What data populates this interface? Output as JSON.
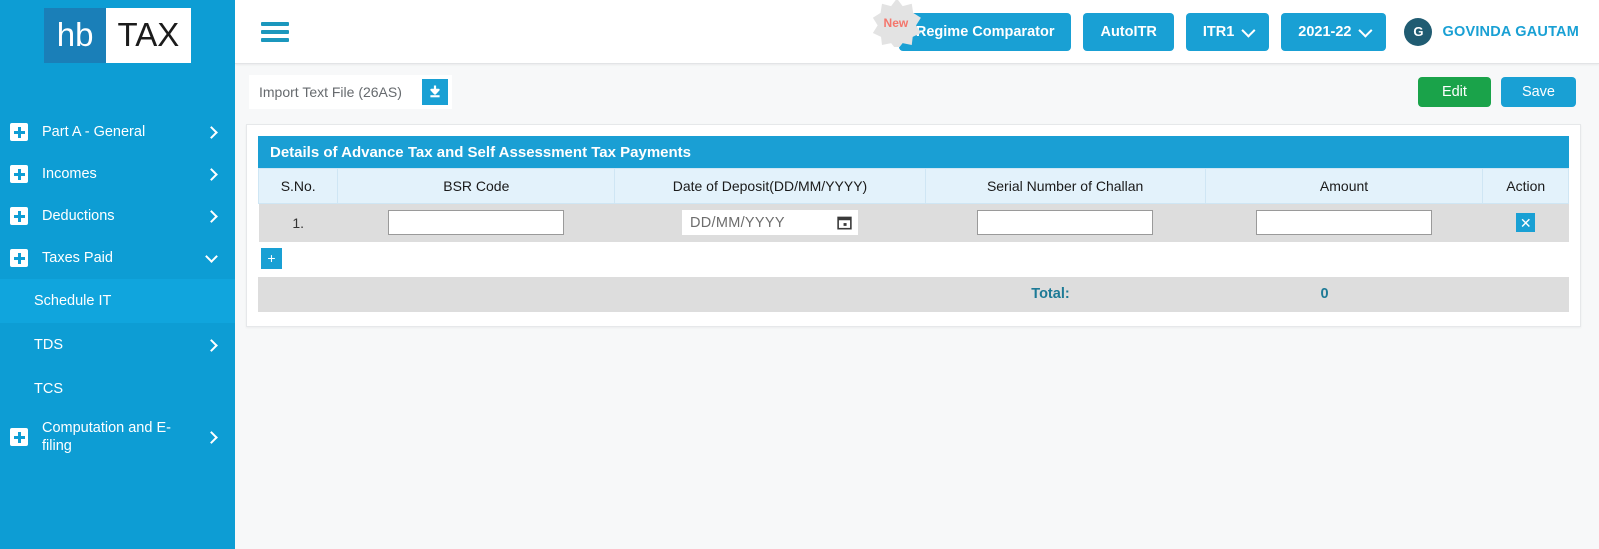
{
  "brand": {
    "logo_primary": "hb",
    "logo_secondary": "TAX",
    "accent_blue": "#0d9dd4",
    "header_blue": "#19a0d4",
    "green": "#1aa34a",
    "teal_text": "#1d7a96"
  },
  "sidebar": {
    "items": [
      {
        "label": "Part A - General",
        "icon": "plus-box-icon",
        "chevron": "chevron-right-icon",
        "level": "top"
      },
      {
        "label": "Incomes",
        "icon": "plus-box-icon",
        "chevron": "chevron-right-icon",
        "level": "top"
      },
      {
        "label": "Deductions",
        "icon": "plus-box-icon",
        "chevron": "chevron-right-icon",
        "level": "top"
      },
      {
        "label": "Taxes Paid",
        "icon": "plus-box-icon",
        "chevron": "chevron-down-icon",
        "level": "top",
        "expanded": true
      },
      {
        "label": "Schedule IT",
        "level": "sub",
        "active": true
      },
      {
        "label": "TDS",
        "level": "sub",
        "chevron": "chevron-right-icon"
      },
      {
        "label": "TCS",
        "level": "sub"
      },
      {
        "label": "Computation and E-filing",
        "icon": "plus-box-icon",
        "chevron": "chevron-right-icon",
        "level": "top"
      }
    ]
  },
  "header": {
    "menu_icon": "hamburger-icon",
    "new_badge": "New",
    "regime_comparator": "Regime Comparator",
    "auto_itr": "AutoITR",
    "itr_form": "ITR1",
    "assessment_year": "2021-22",
    "user_initial": "G",
    "user_name": "GOVINDA GAUTAM"
  },
  "actionbar": {
    "import_label": "Import Text File (26AS)",
    "download_icon": "download-icon",
    "edit_label": "Edit",
    "save_label": "Save"
  },
  "panel": {
    "title": "Details of Advance Tax and Self Assessment Tax Payments",
    "columns": [
      "S.No.",
      "BSR Code",
      "Date of Deposit(DD/MM/YYYY)",
      "Serial Number of Challan",
      "Amount",
      "Action"
    ],
    "rows": [
      {
        "sno": "1.",
        "bsr_code": "",
        "bsr_placeholder": "",
        "date_of_deposit": "",
        "date_placeholder": "DD/MM/YYYY",
        "serial_number": "",
        "serial_placeholder": "",
        "amount": "",
        "amount_placeholder": "",
        "action_icon": "close-icon",
        "action_label": "✕"
      }
    ],
    "add_row_label": "+",
    "total_label": "Total:",
    "total_value": "0"
  }
}
